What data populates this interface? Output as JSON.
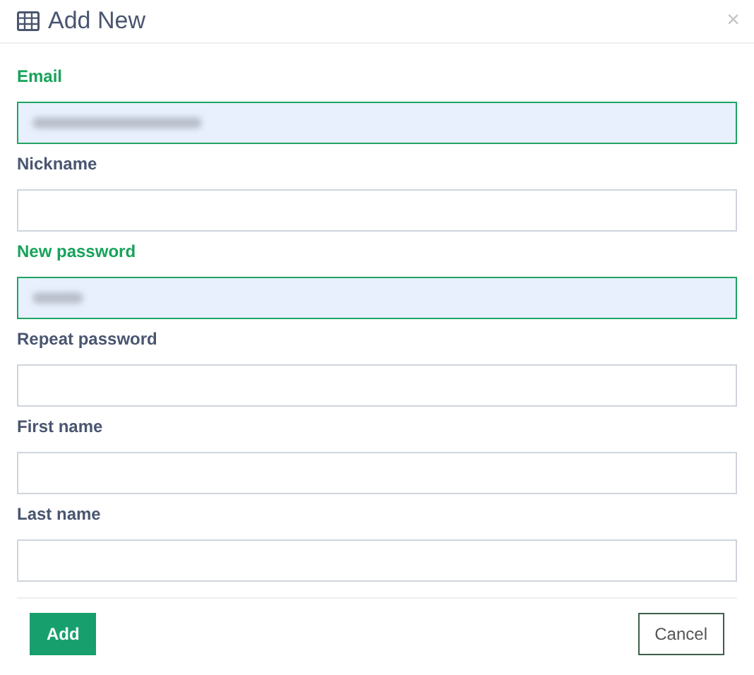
{
  "dialog": {
    "title": "Add New",
    "close": "×"
  },
  "fields": [
    {
      "label": "Email",
      "kind": "email",
      "autofilled": true
    },
    {
      "label": "Nickname",
      "autofilled": false
    },
    {
      "label": "New password",
      "kind": "password",
      "autofilled": true
    },
    {
      "label": "Repeat password",
      "autofilled": false
    },
    {
      "label": "First name",
      "autofilled": false
    },
    {
      "label": "Last name",
      "autofilled": false
    }
  ],
  "buttons": [
    {
      "label": "Add",
      "kind": "primary"
    },
    {
      "label": "Cancel",
      "kind": "secondary"
    }
  ]
}
